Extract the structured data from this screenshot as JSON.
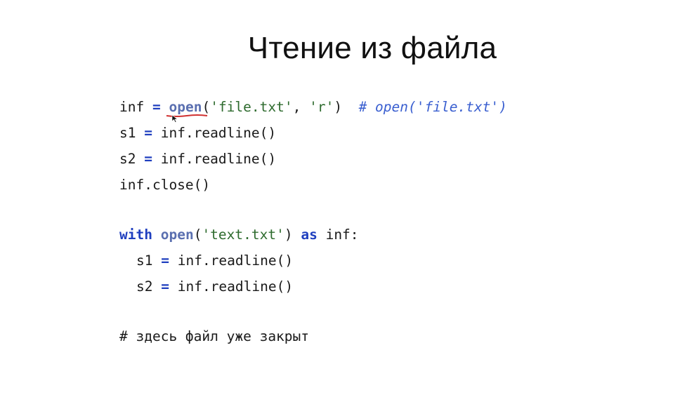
{
  "slide": {
    "title": "Чтение из файла"
  },
  "block1": {
    "line1": {
      "var": "inf",
      "eq": "=",
      "func": "open",
      "lparen": "(",
      "arg1": "'file.txt'",
      "sep": ", ",
      "arg2": "'r'",
      "rparen": ")",
      "comment": "# open('file.txt')"
    },
    "line2": {
      "var": "s1",
      "eq": "=",
      "call": "inf.readline()"
    },
    "line3": {
      "var": "s2",
      "eq": "=",
      "call": "inf.readline()"
    },
    "line4": {
      "call": "inf.close()"
    }
  },
  "block2": {
    "line1": {
      "kw_with": "with",
      "func": "open",
      "lparen": "(",
      "arg": "'text.txt'",
      "rparen": ")",
      "kw_as": "as",
      "target": "inf:"
    },
    "line2": {
      "var": "s1",
      "eq": "=",
      "call": "inf.readline()"
    },
    "line3": {
      "var": "s2",
      "eq": "=",
      "call": "inf.readline()"
    }
  },
  "footer_comment": "# здесь файл уже закрыт",
  "colors": {
    "operator": "#1f3fbf",
    "function": "#5a6fb0",
    "string": "#2e6b2e",
    "comment": "#3a5fd0",
    "annotation_underline": "#d03030"
  }
}
